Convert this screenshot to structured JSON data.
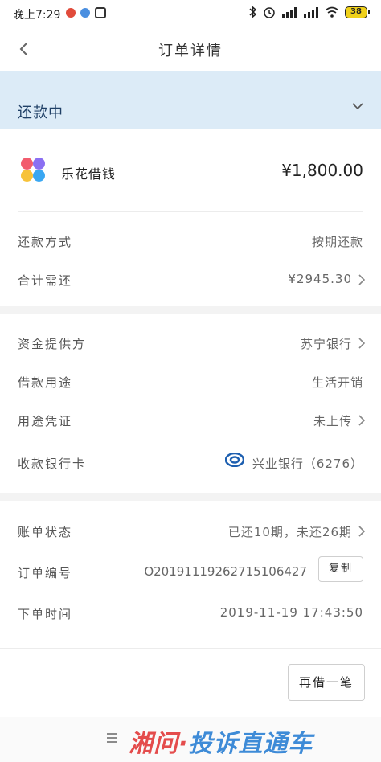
{
  "status_bar": {
    "time": "晚上7:29",
    "battery": "38"
  },
  "nav": {
    "title": "订单详情"
  },
  "banner": {
    "status": "还款中"
  },
  "product": {
    "name": "乐花借钱",
    "amount": "¥1,800.00"
  },
  "repayment": [
    {
      "label": "还款方式",
      "value": "按期还款"
    },
    {
      "label": "合计需还",
      "value": "¥2945.30"
    }
  ],
  "funding": [
    {
      "label": "资金提供方",
      "value": "苏宁银行"
    },
    {
      "label": "借款用途",
      "value": "生活开销"
    },
    {
      "label": "用途凭证",
      "value": "未上传"
    },
    {
      "label": "收款银行卡",
      "value": "兴业银行（6276）"
    }
  ],
  "order": {
    "bill_status_label": "账单状态",
    "bill_status_value": "已还10期，未还26期",
    "order_no_label": "订单编号",
    "order_no_value": "O20191119262715106427",
    "copy_label": "复制",
    "order_time_label": "下单时间",
    "order_time_value": "2019-11-19 17:43:50"
  },
  "actions": {
    "reborrow_label": "再借一笔"
  },
  "watermark": {
    "part1": "湘问·",
    "part2": "投诉直通车"
  },
  "colors": {
    "banner_bg": "#dcebf7",
    "banner_text": "#1f3f66",
    "petal_red": "#f25c6e",
    "petal_purple": "#8b6ff2",
    "petal_yellow": "#f7c23a",
    "petal_blue": "#3aa7f2",
    "bank_blue": "#1d5fb0"
  },
  "icons": [
    "back-arrow-icon",
    "chevron-down-icon",
    "chevron-right-icon",
    "bank-logo-icon",
    "bluetooth-icon",
    "alarm-icon",
    "signal-icon",
    "wifi-icon",
    "battery-icon",
    "menu-icon"
  ]
}
